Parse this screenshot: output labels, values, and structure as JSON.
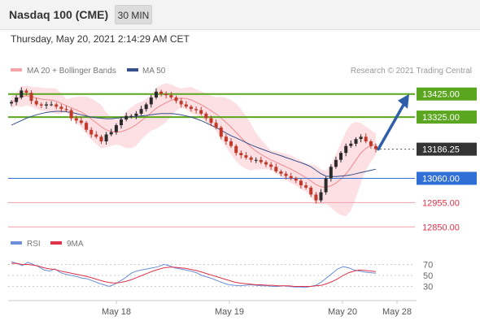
{
  "header": {
    "title": "Nasdaq 100 (CME)",
    "timeframe_button": "30 MIN"
  },
  "timestamp": "Thursday, May 20, 2021 2:14:29 AM CET",
  "legend": {
    "bollinger": "MA 20 + Bollinger Bands",
    "ma50": "MA 50",
    "rsi": "RSI",
    "rsi_ma": "9MA"
  },
  "credit": "Research © 2021 Trading Central",
  "colors": {
    "resistance": "#5aa61e",
    "current": "#333333",
    "support_blue": "#2f6fd6",
    "support_red": "#e0334a",
    "bollinger_fill": "#fde0e3",
    "ma20": "#ee8a8f",
    "ma50": "#35508a",
    "candle_up": "#2b2b2b",
    "candle_down": "#c0392b",
    "forecast_arrow": "#2e5fa8",
    "rsi_line": "#6b8fd8",
    "rsi_ma_line": "#e0334a"
  },
  "chart_data": [
    {
      "type": "line",
      "title": "Nasdaq 100 (CME)",
      "x_ticks": [
        "May 18",
        "May 19",
        "May 20",
        "May 28"
      ],
      "levels": [
        {
          "label": "13425.00",
          "kind": "resistance"
        },
        {
          "label": "13325.00",
          "kind": "resistance"
        },
        {
          "label": "13186.25",
          "kind": "current"
        },
        {
          "label": "13060.00",
          "kind": "support"
        },
        {
          "label": "12955.00",
          "kind": "support"
        },
        {
          "label": "12850.00",
          "kind": "support"
        }
      ],
      "forecast": {
        "from": 13186.25,
        "to": 13425.0
      },
      "ylim": [
        12830,
        13480
      ],
      "close_series": [
        13390,
        13410,
        13440,
        13430,
        13395,
        13380,
        13375,
        13380,
        13380,
        13370,
        13360,
        13355,
        13320,
        13310,
        13300,
        13270,
        13250,
        13240,
        13220,
        13250,
        13260,
        13290,
        13315,
        13330,
        13330,
        13340,
        13360,
        13380,
        13410,
        13435,
        13425,
        13420,
        13410,
        13395,
        13380,
        13370,
        13360,
        13355,
        13340,
        13320,
        13300,
        13280,
        13240,
        13220,
        13200,
        13170,
        13160,
        13150,
        13140,
        13140,
        13130,
        13120,
        13110,
        13090,
        13080,
        13070,
        13060,
        13050,
        13030,
        13020,
        12990,
        12965,
        13000,
        13060,
        13110,
        13140,
        13170,
        13200,
        13210,
        13230,
        13240,
        13220,
        13200,
        13186.25
      ],
      "ma50_series": [
        13290,
        13300,
        13310,
        13320,
        13328,
        13335,
        13340,
        13345,
        13348,
        13350,
        13350,
        13348,
        13345,
        13340,
        13335,
        13330,
        13325,
        13322,
        13320,
        13318,
        13318,
        13320,
        13322,
        13324,
        13326,
        13328,
        13330,
        13332,
        13335,
        13338,
        13340,
        13340,
        13340,
        13338,
        13335,
        13330,
        13325,
        13318,
        13310,
        13300,
        13290,
        13280,
        13268,
        13256,
        13245,
        13235,
        13225,
        13215,
        13205,
        13196,
        13188,
        13180,
        13172,
        13165,
        13158,
        13150,
        13143,
        13135,
        13128,
        13120,
        13110,
        13095,
        13080,
        13070,
        13068,
        13068,
        13070,
        13072,
        13075,
        13080,
        13085,
        13090,
        13095,
        13100
      ]
    },
    {
      "type": "line",
      "title": "RSI",
      "y_ticks": [
        70,
        50,
        30
      ],
      "ylim": [
        10,
        90
      ],
      "series": [
        {
          "name": "RSI",
          "values": [
            75,
            72,
            68,
            74,
            70,
            66,
            60,
            58,
            62,
            55,
            52,
            50,
            48,
            45,
            44,
            40,
            36,
            33,
            30,
            34,
            40,
            46,
            54,
            58,
            60,
            62,
            64,
            66,
            70,
            68,
            64,
            62,
            60,
            58,
            55,
            50,
            47,
            44,
            40,
            36,
            33,
            32,
            31,
            32,
            33,
            32,
            31,
            31,
            30,
            30,
            31,
            30,
            29,
            29,
            28,
            30,
            32,
            38,
            46,
            54,
            62,
            66,
            64,
            60,
            58,
            56,
            55,
            54
          ]
        },
        {
          "name": "9MA",
          "values": [
            72,
            72,
            70,
            70,
            69,
            67,
            64,
            62,
            61,
            58,
            56,
            54,
            52,
            50,
            48,
            45,
            42,
            39,
            37,
            36,
            37,
            39,
            42,
            46,
            50,
            54,
            58,
            61,
            64,
            65,
            65,
            64,
            63,
            61,
            59,
            56,
            53,
            50,
            47,
            44,
            41,
            38,
            36,
            35,
            34,
            33,
            33,
            32,
            32,
            31,
            31,
            31,
            30,
            30,
            30,
            30,
            31,
            32,
            35,
            39,
            44,
            50,
            55,
            58,
            60,
            59,
            58,
            57
          ]
        }
      ]
    }
  ]
}
